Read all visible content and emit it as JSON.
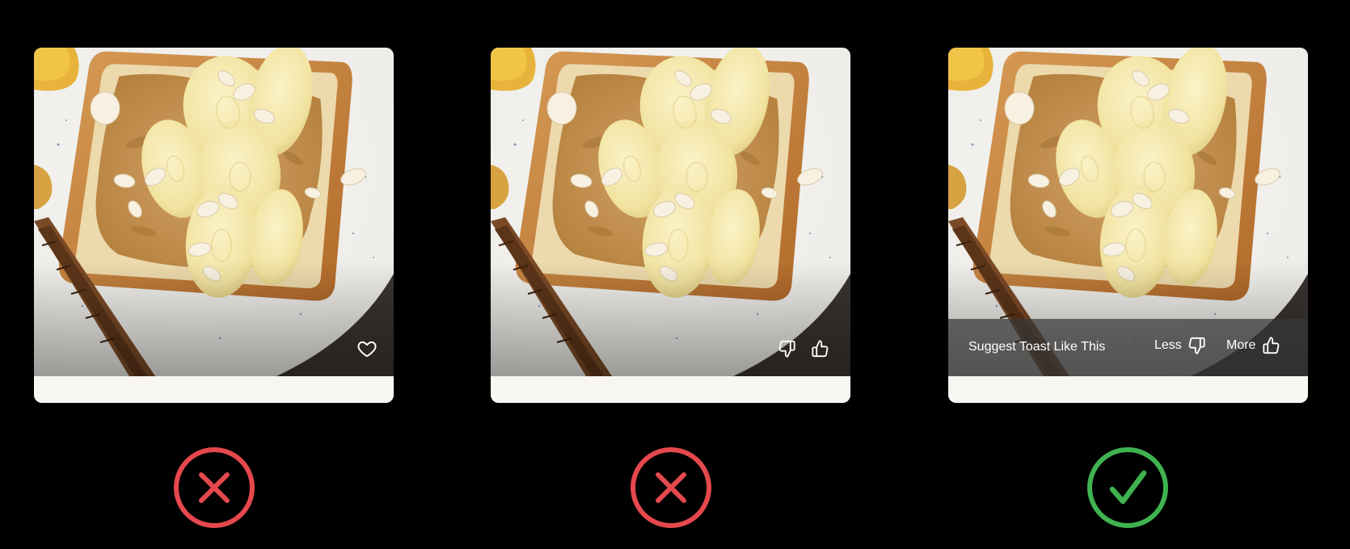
{
  "cards": [
    {
      "variant": "heart",
      "icons": [
        "heart-icon"
      ]
    },
    {
      "variant": "thumbs",
      "icons": [
        "thumbs-down-icon",
        "thumbs-up-icon"
      ]
    },
    {
      "variant": "suggest",
      "suggest_label": "Suggest Toast Like This",
      "less_label": "Less",
      "more_label": "More",
      "icons": [
        "thumbs-down-icon",
        "thumbs-up-icon"
      ]
    }
  ],
  "verdicts": [
    {
      "type": "wrong",
      "icon": "x-circle-icon",
      "color": "#e5484d"
    },
    {
      "type": "wrong",
      "icon": "x-circle-icon",
      "color": "#e5484d"
    },
    {
      "type": "correct",
      "icon": "check-circle-icon",
      "color": "#3fb350"
    }
  ],
  "colors": {
    "background": "#000000",
    "wrong": "#e5484d",
    "correct": "#3fb350",
    "overlay": "#373737"
  }
}
